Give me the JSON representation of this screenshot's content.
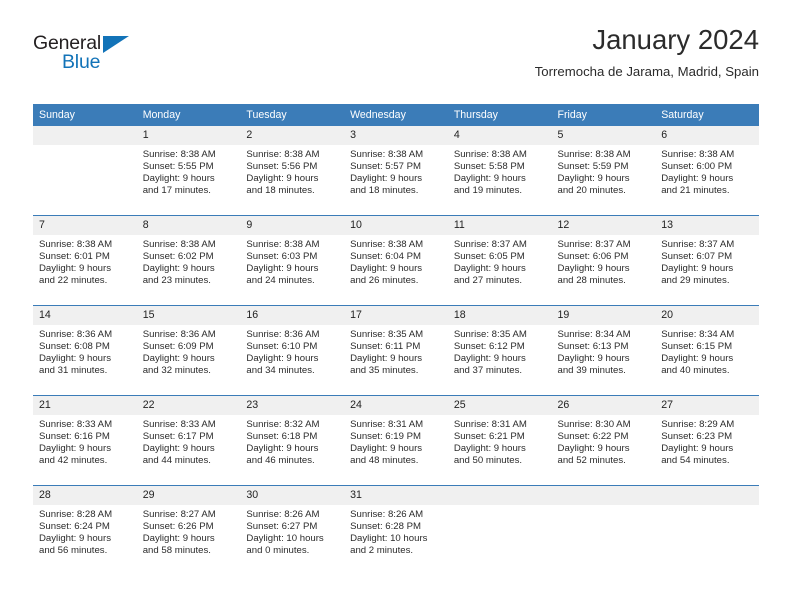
{
  "brand": {
    "name_part1": "General",
    "name_part2": "Blue",
    "triangle_color": "#1273b8",
    "text_color": "#231f20"
  },
  "header": {
    "title": "January 2024",
    "location": "Torremocha de Jarama, Madrid, Spain",
    "accent_color": "#3b7cb8",
    "daynum_band_color": "#f0f0f0"
  },
  "weekdays": [
    "Sunday",
    "Monday",
    "Tuesday",
    "Wednesday",
    "Thursday",
    "Friday",
    "Saturday"
  ],
  "weeks": [
    [
      {
        "day": "",
        "empty": true,
        "blank": false,
        "sunrise": "",
        "sunset": "",
        "daylight1": "",
        "daylight2": ""
      },
      {
        "day": "1",
        "sunrise": "Sunrise: 8:38 AM",
        "sunset": "Sunset: 5:55 PM",
        "daylight1": "Daylight: 9 hours",
        "daylight2": "and 17 minutes."
      },
      {
        "day": "2",
        "sunrise": "Sunrise: 8:38 AM",
        "sunset": "Sunset: 5:56 PM",
        "daylight1": "Daylight: 9 hours",
        "daylight2": "and 18 minutes."
      },
      {
        "day": "3",
        "sunrise": "Sunrise: 8:38 AM",
        "sunset": "Sunset: 5:57 PM",
        "daylight1": "Daylight: 9 hours",
        "daylight2": "and 18 minutes."
      },
      {
        "day": "4",
        "sunrise": "Sunrise: 8:38 AM",
        "sunset": "Sunset: 5:58 PM",
        "daylight1": "Daylight: 9 hours",
        "daylight2": "and 19 minutes."
      },
      {
        "day": "5",
        "sunrise": "Sunrise: 8:38 AM",
        "sunset": "Sunset: 5:59 PM",
        "daylight1": "Daylight: 9 hours",
        "daylight2": "and 20 minutes."
      },
      {
        "day": "6",
        "sunrise": "Sunrise: 8:38 AM",
        "sunset": "Sunset: 6:00 PM",
        "daylight1": "Daylight: 9 hours",
        "daylight2": "and 21 minutes."
      }
    ],
    [
      {
        "day": "7",
        "sunrise": "Sunrise: 8:38 AM",
        "sunset": "Sunset: 6:01 PM",
        "daylight1": "Daylight: 9 hours",
        "daylight2": "and 22 minutes."
      },
      {
        "day": "8",
        "sunrise": "Sunrise: 8:38 AM",
        "sunset": "Sunset: 6:02 PM",
        "daylight1": "Daylight: 9 hours",
        "daylight2": "and 23 minutes."
      },
      {
        "day": "9",
        "sunrise": "Sunrise: 8:38 AM",
        "sunset": "Sunset: 6:03 PM",
        "daylight1": "Daylight: 9 hours",
        "daylight2": "and 24 minutes."
      },
      {
        "day": "10",
        "sunrise": "Sunrise: 8:38 AM",
        "sunset": "Sunset: 6:04 PM",
        "daylight1": "Daylight: 9 hours",
        "daylight2": "and 26 minutes."
      },
      {
        "day": "11",
        "sunrise": "Sunrise: 8:37 AM",
        "sunset": "Sunset: 6:05 PM",
        "daylight1": "Daylight: 9 hours",
        "daylight2": "and 27 minutes."
      },
      {
        "day": "12",
        "sunrise": "Sunrise: 8:37 AM",
        "sunset": "Sunset: 6:06 PM",
        "daylight1": "Daylight: 9 hours",
        "daylight2": "and 28 minutes."
      },
      {
        "day": "13",
        "sunrise": "Sunrise: 8:37 AM",
        "sunset": "Sunset: 6:07 PM",
        "daylight1": "Daylight: 9 hours",
        "daylight2": "and 29 minutes."
      }
    ],
    [
      {
        "day": "14",
        "sunrise": "Sunrise: 8:36 AM",
        "sunset": "Sunset: 6:08 PM",
        "daylight1": "Daylight: 9 hours",
        "daylight2": "and 31 minutes."
      },
      {
        "day": "15",
        "sunrise": "Sunrise: 8:36 AM",
        "sunset": "Sunset: 6:09 PM",
        "daylight1": "Daylight: 9 hours",
        "daylight2": "and 32 minutes."
      },
      {
        "day": "16",
        "sunrise": "Sunrise: 8:36 AM",
        "sunset": "Sunset: 6:10 PM",
        "daylight1": "Daylight: 9 hours",
        "daylight2": "and 34 minutes."
      },
      {
        "day": "17",
        "sunrise": "Sunrise: 8:35 AM",
        "sunset": "Sunset: 6:11 PM",
        "daylight1": "Daylight: 9 hours",
        "daylight2": "and 35 minutes."
      },
      {
        "day": "18",
        "sunrise": "Sunrise: 8:35 AM",
        "sunset": "Sunset: 6:12 PM",
        "daylight1": "Daylight: 9 hours",
        "daylight2": "and 37 minutes."
      },
      {
        "day": "19",
        "sunrise": "Sunrise: 8:34 AM",
        "sunset": "Sunset: 6:13 PM",
        "daylight1": "Daylight: 9 hours",
        "daylight2": "and 39 minutes."
      },
      {
        "day": "20",
        "sunrise": "Sunrise: 8:34 AM",
        "sunset": "Sunset: 6:15 PM",
        "daylight1": "Daylight: 9 hours",
        "daylight2": "and 40 minutes."
      }
    ],
    [
      {
        "day": "21",
        "sunrise": "Sunrise: 8:33 AM",
        "sunset": "Sunset: 6:16 PM",
        "daylight1": "Daylight: 9 hours",
        "daylight2": "and 42 minutes."
      },
      {
        "day": "22",
        "sunrise": "Sunrise: 8:33 AM",
        "sunset": "Sunset: 6:17 PM",
        "daylight1": "Daylight: 9 hours",
        "daylight2": "and 44 minutes."
      },
      {
        "day": "23",
        "sunrise": "Sunrise: 8:32 AM",
        "sunset": "Sunset: 6:18 PM",
        "daylight1": "Daylight: 9 hours",
        "daylight2": "and 46 minutes."
      },
      {
        "day": "24",
        "sunrise": "Sunrise: 8:31 AM",
        "sunset": "Sunset: 6:19 PM",
        "daylight1": "Daylight: 9 hours",
        "daylight2": "and 48 minutes."
      },
      {
        "day": "25",
        "sunrise": "Sunrise: 8:31 AM",
        "sunset": "Sunset: 6:21 PM",
        "daylight1": "Daylight: 9 hours",
        "daylight2": "and 50 minutes."
      },
      {
        "day": "26",
        "sunrise": "Sunrise: 8:30 AM",
        "sunset": "Sunset: 6:22 PM",
        "daylight1": "Daylight: 9 hours",
        "daylight2": "and 52 minutes."
      },
      {
        "day": "27",
        "sunrise": "Sunrise: 8:29 AM",
        "sunset": "Sunset: 6:23 PM",
        "daylight1": "Daylight: 9 hours",
        "daylight2": "and 54 minutes."
      }
    ],
    [
      {
        "day": "28",
        "sunrise": "Sunrise: 8:28 AM",
        "sunset": "Sunset: 6:24 PM",
        "daylight1": "Daylight: 9 hours",
        "daylight2": "and 56 minutes."
      },
      {
        "day": "29",
        "sunrise": "Sunrise: 8:27 AM",
        "sunset": "Sunset: 6:26 PM",
        "daylight1": "Daylight: 9 hours",
        "daylight2": "and 58 minutes."
      },
      {
        "day": "30",
        "sunrise": "Sunrise: 8:26 AM",
        "sunset": "Sunset: 6:27 PM",
        "daylight1": "Daylight: 10 hours",
        "daylight2": "and 0 minutes."
      },
      {
        "day": "31",
        "sunrise": "Sunrise: 8:26 AM",
        "sunset": "Sunset: 6:28 PM",
        "daylight1": "Daylight: 10 hours",
        "daylight2": "and 2 minutes."
      },
      {
        "day": "",
        "empty": true,
        "sunrise": "",
        "sunset": "",
        "daylight1": "",
        "daylight2": ""
      },
      {
        "day": "",
        "empty": true,
        "sunrise": "",
        "sunset": "",
        "daylight1": "",
        "daylight2": ""
      },
      {
        "day": "",
        "empty": true,
        "sunrise": "",
        "sunset": "",
        "daylight1": "",
        "daylight2": ""
      }
    ]
  ]
}
